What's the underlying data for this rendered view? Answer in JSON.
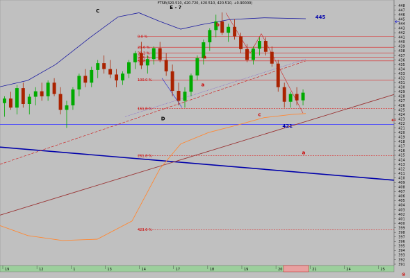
{
  "header": {
    "title": "FTSE(420.510, 420.720, 420.510, 420.510, +0.90000)",
    "wave_label": "E - ?"
  },
  "colors": {
    "background": "#c0c0c0",
    "up_candle": "#00aa00",
    "down_candle": "#aa2200",
    "moving_average_blue": "#1a1aa0",
    "moving_average_orange": "#ff8833",
    "fib_line": "#dd2222",
    "support_line": "#4444ff",
    "trend_blue": "#0000aa",
    "trend_brown": "#993333"
  },
  "chart_data": {
    "type": "candlestick",
    "y_axis": {
      "range": [
        391,
        448
      ],
      "ticks": [
        391,
        392,
        393,
        394,
        395,
        396,
        397,
        398,
        399,
        400,
        401,
        402,
        403,
        404,
        405,
        406,
        407,
        408,
        409,
        410,
        411,
        412,
        413,
        414,
        415,
        416,
        417,
        418,
        419,
        420,
        421,
        422,
        423,
        424,
        425,
        426,
        427,
        428,
        429,
        430,
        431,
        432,
        433,
        434,
        435,
        436,
        437,
        438,
        439,
        440,
        441,
        442,
        443,
        444,
        445,
        446,
        447,
        448
      ]
    },
    "x_axis": {
      "ticks": [
        "19",
        "12",
        "1",
        "13",
        "14",
        "17",
        "18",
        "19",
        "20",
        "21",
        "24",
        "25"
      ]
    },
    "fib_levels": [
      {
        "label": "0.0 %",
        "value": 441.2
      },
      {
        "label": "23.6 %",
        "value": 438.8
      },
      {
        "label": "38.2 %",
        "value": 437.5
      },
      {
        "label": "50.0 %",
        "value": 436.6
      },
      {
        "label": "61.8 %",
        "value": 435.8
      },
      {
        "label": "100.0 %",
        "value": 431.6
      },
      {
        "label": "161.8 %",
        "value": 425.3
      },
      {
        "label": "261.8 %",
        "value": 414.9
      },
      {
        "label": "423.6 %",
        "value": 398.6
      }
    ],
    "horizontal_lines": [
      {
        "value": 421.8,
        "label": "421"
      }
    ],
    "annotations": [
      {
        "text": "C",
        "x": 15,
        "y": 446.5,
        "color": "#000000"
      },
      {
        "text": "E - ?",
        "x": 27.5,
        "y": 447.2,
        "color": "#000000"
      },
      {
        "text": "b",
        "x": 34.3,
        "y": 443.4,
        "color": "#cc0000"
      },
      {
        "text": "a",
        "x": 32.2,
        "y": 436.3,
        "color": "#cc0000"
      },
      {
        "text": "c",
        "x": 41.0,
        "y": 423.6,
        "color": "#cc0000"
      },
      {
        "text": "a",
        "x": 31.9,
        "y": 430.2,
        "color": "#cc0000"
      },
      {
        "text": "D",
        "x": 25.5,
        "y": 422.7,
        "color": "#000000"
      },
      {
        "text": "445",
        "x": 50.8,
        "y": 445.1,
        "color": "#0000aa"
      },
      {
        "text": "421",
        "x": 45.5,
        "y": 421.1,
        "color": "#0000aa"
      },
      {
        "text": "a",
        "x": 48.1,
        "y": 415.2,
        "color": "#cc0000"
      }
    ],
    "candles": [
      {
        "o": 426.5,
        "h": 428.0,
        "l": 423.5,
        "c": 427.5
      },
      {
        "o": 427.5,
        "h": 429.0,
        "l": 425.0,
        "c": 425.5
      },
      {
        "o": 425.5,
        "h": 430.5,
        "l": 424.0,
        "c": 429.8
      },
      {
        "o": 429.8,
        "h": 431.0,
        "l": 425.5,
        "c": 426.3
      },
      {
        "o": 426.3,
        "h": 428.5,
        "l": 424.0,
        "c": 427.9
      },
      {
        "o": 427.9,
        "h": 430.0,
        "l": 426.0,
        "c": 429.1
      },
      {
        "o": 429.1,
        "h": 431.0,
        "l": 427.0,
        "c": 428.0
      },
      {
        "o": 428.0,
        "h": 431.5,
        "l": 427.0,
        "c": 431.0
      },
      {
        "o": 431.0,
        "h": 432.0,
        "l": 428.0,
        "c": 428.5
      },
      {
        "o": 428.5,
        "h": 430.0,
        "l": 424.0,
        "c": 425.0
      },
      {
        "o": 425.0,
        "h": 427.0,
        "l": 421.0,
        "c": 426.0
      },
      {
        "o": 426.0,
        "h": 430.0,
        "l": 425.0,
        "c": 429.5
      },
      {
        "o": 429.5,
        "h": 433.0,
        "l": 428.0,
        "c": 432.5
      },
      {
        "o": 432.5,
        "h": 434.0,
        "l": 430.0,
        "c": 431.0
      },
      {
        "o": 431.0,
        "h": 434.5,
        "l": 430.0,
        "c": 433.8
      },
      {
        "o": 433.8,
        "h": 436.0,
        "l": 432.0,
        "c": 435.3
      },
      {
        "o": 435.3,
        "h": 437.0,
        "l": 433.0,
        "c": 434.0
      },
      {
        "o": 434.0,
        "h": 436.0,
        "l": 432.0,
        "c": 432.8
      },
      {
        "o": 432.8,
        "h": 434.0,
        "l": 430.0,
        "c": 431.5
      },
      {
        "o": 431.5,
        "h": 433.5,
        "l": 430.5,
        "c": 433.0
      },
      {
        "o": 433.0,
        "h": 436.0,
        "l": 432.0,
        "c": 435.5
      },
      {
        "o": 435.5,
        "h": 438.0,
        "l": 434.0,
        "c": 437.5
      },
      {
        "o": 437.5,
        "h": 440.0,
        "l": 434.0,
        "c": 434.8
      },
      {
        "o": 434.8,
        "h": 437.0,
        "l": 433.0,
        "c": 436.2
      },
      {
        "o": 436.2,
        "h": 439.0,
        "l": 435.0,
        "c": 438.6
      },
      {
        "o": 438.6,
        "h": 440.0,
        "l": 435.5,
        "c": 436.0
      },
      {
        "o": 436.0,
        "h": 437.5,
        "l": 432.5,
        "c": 433.5
      },
      {
        "o": 433.5,
        "h": 435.0,
        "l": 428.0,
        "c": 429.2
      },
      {
        "o": 429.2,
        "h": 431.0,
        "l": 426.0,
        "c": 427.0
      },
      {
        "o": 427.0,
        "h": 430.0,
        "l": 425.5,
        "c": 429.0
      },
      {
        "o": 429.0,
        "h": 433.0,
        "l": 428.0,
        "c": 432.6
      },
      {
        "o": 432.6,
        "h": 437.0,
        "l": 431.5,
        "c": 436.4
      },
      {
        "o": 436.4,
        "h": 440.5,
        "l": 435.0,
        "c": 439.9
      },
      {
        "o": 439.9,
        "h": 443.0,
        "l": 438.0,
        "c": 442.6
      },
      {
        "o": 442.6,
        "h": 446.0,
        "l": 441.0,
        "c": 444.5
      },
      {
        "o": 444.5,
        "h": 446.5,
        "l": 441.5,
        "c": 442.0
      },
      {
        "o": 442.0,
        "h": 444.0,
        "l": 440.0,
        "c": 443.3
      },
      {
        "o": 443.3,
        "h": 445.0,
        "l": 440.5,
        "c": 441.2
      },
      {
        "o": 441.2,
        "h": 442.0,
        "l": 437.5,
        "c": 438.4
      },
      {
        "o": 438.4,
        "h": 439.5,
        "l": 435.5,
        "c": 436.0
      },
      {
        "o": 436.0,
        "h": 439.0,
        "l": 435.0,
        "c": 438.5
      },
      {
        "o": 438.5,
        "h": 441.0,
        "l": 437.0,
        "c": 440.2
      },
      {
        "o": 440.2,
        "h": 441.0,
        "l": 437.0,
        "c": 437.8
      },
      {
        "o": 437.8,
        "h": 439.0,
        "l": 434.5,
        "c": 435.2
      },
      {
        "o": 435.2,
        "h": 436.0,
        "l": 429.0,
        "c": 430.0
      },
      {
        "o": 430.0,
        "h": 431.0,
        "l": 425.5,
        "c": 426.8
      },
      {
        "o": 426.8,
        "h": 429.0,
        "l": 425.5,
        "c": 428.5
      },
      {
        "o": 428.5,
        "h": 430.0,
        "l": 426.0,
        "c": 427.1
      },
      {
        "o": 427.1,
        "h": 429.5,
        "l": 426.0,
        "c": 428.8
      }
    ]
  },
  "right_markers": {
    "arrow_right": "←",
    "arrow_left": "←"
  },
  "bottom_icon": "⊗"
}
